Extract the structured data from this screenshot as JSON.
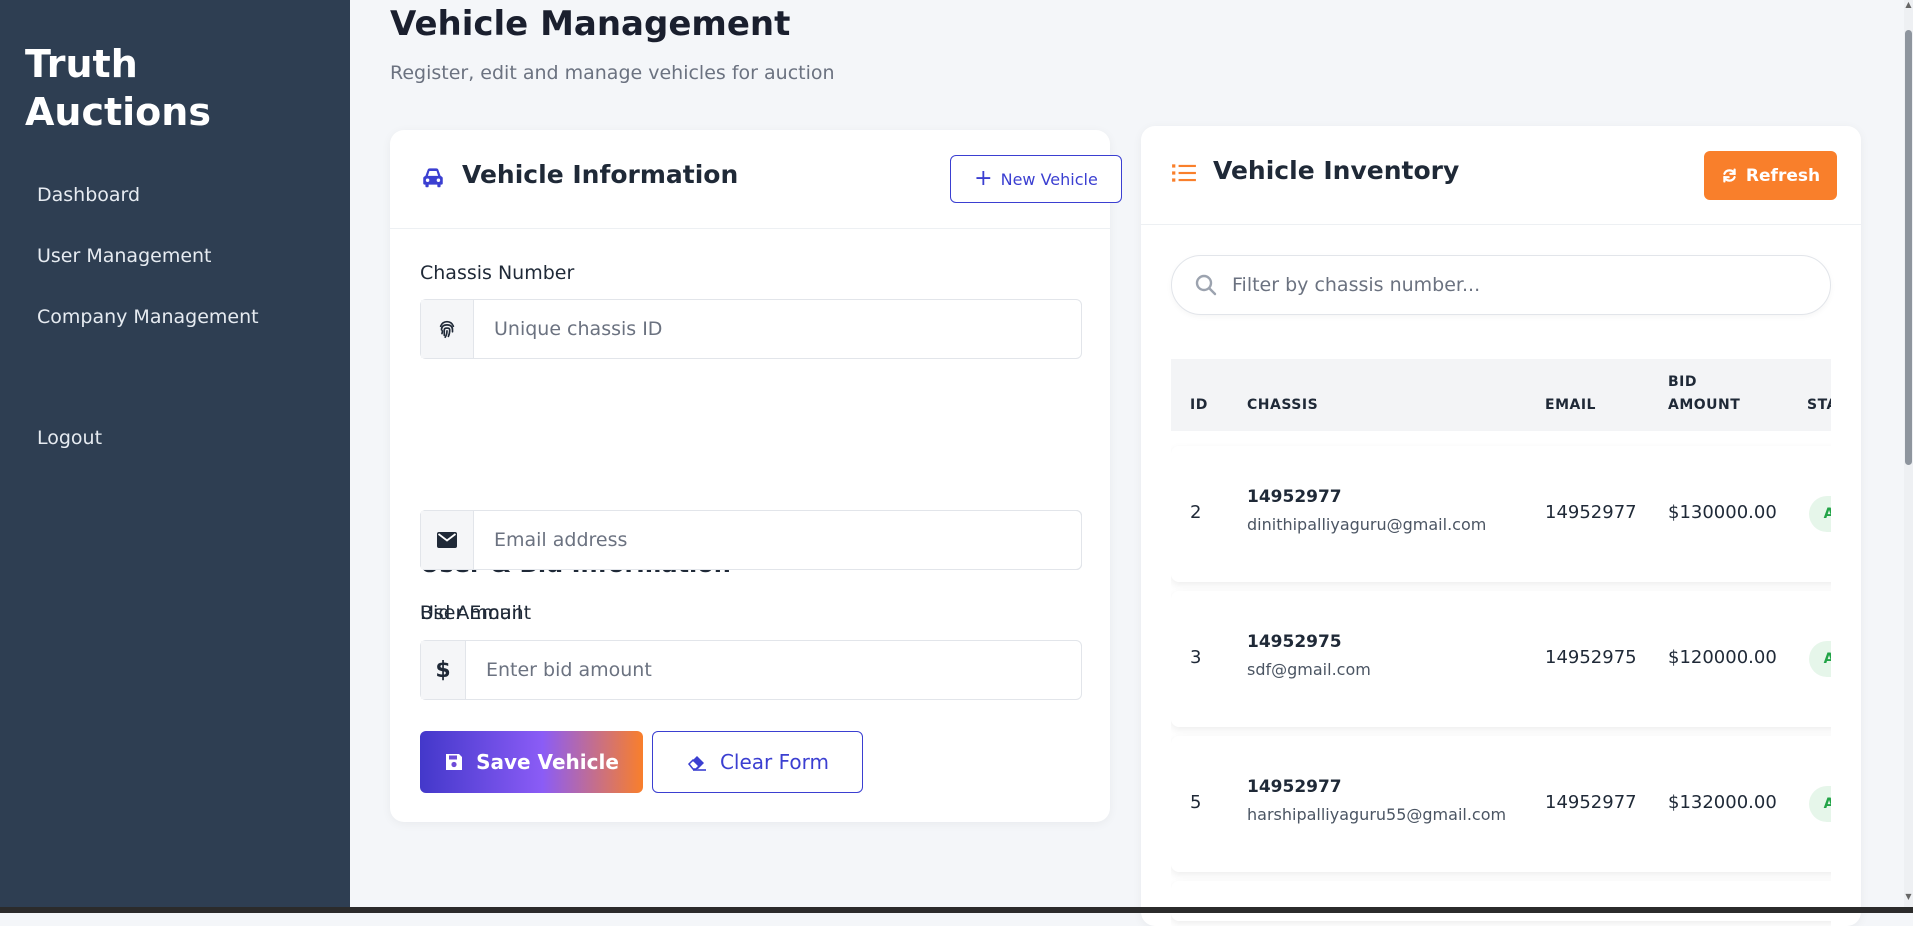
{
  "sidebar": {
    "brand": "Truth Auctions",
    "items": [
      {
        "label": "Dashboard"
      },
      {
        "label": "User Management"
      },
      {
        "label": "Company Management"
      }
    ],
    "logout": "Logout"
  },
  "page": {
    "title": "Vehicle Management",
    "subtitle": "Register, edit and manage vehicles for auction"
  },
  "form": {
    "title": "Vehicle Information",
    "new_button": "New Vehicle",
    "chassis_label": "Chassis Number",
    "chassis_placeholder": "Unique chassis ID",
    "section_title": "User & Bid Information",
    "email_label": "User Email",
    "email_placeholder": "Email address",
    "bid_label": "Bid Amount",
    "bid_addon": "$",
    "bid_placeholder": "Enter bid amount",
    "save_button": "Save Vehicle",
    "clear_button": "Clear Form"
  },
  "inventory": {
    "title": "Vehicle Inventory",
    "refresh_button": "Refresh",
    "search_placeholder": "Filter by chassis number...",
    "columns": {
      "id": "ID",
      "chassis": "CHASSIS",
      "email": "EMAIL",
      "bid": "BID AMOUNT",
      "status": "STA"
    },
    "rows": [
      {
        "id": "2",
        "chassis": "14952977",
        "email_sub": "dinithipalliyaguru@gmail.com",
        "email_col": "14952977",
        "bid": "$130000.00",
        "status": "A"
      },
      {
        "id": "3",
        "chassis": "14952975",
        "email_sub": "sdf@gmail.com",
        "email_col": "14952975",
        "bid": "$120000.00",
        "status": "A"
      },
      {
        "id": "5",
        "chassis": "14952977",
        "email_sub": "harshipalliyaguru55@gmail.com",
        "email_col": "14952977",
        "bid": "$132000.00",
        "status": "A"
      }
    ]
  },
  "colors": {
    "sidebar": "#2e3e52",
    "primary": "#3b3fd1",
    "accent": "#f97f2b",
    "status_bg": "#e6f6ea",
    "status_text": "#22a447"
  },
  "icons": {
    "vehicle": "car-icon",
    "list": "list-icon",
    "fingerprint": "fingerprint-icon",
    "email": "envelope-icon",
    "save": "floppy-disk-icon",
    "clear": "eraser-icon",
    "refresh": "refresh-icon",
    "search": "search-icon",
    "plus": "plus-icon"
  }
}
